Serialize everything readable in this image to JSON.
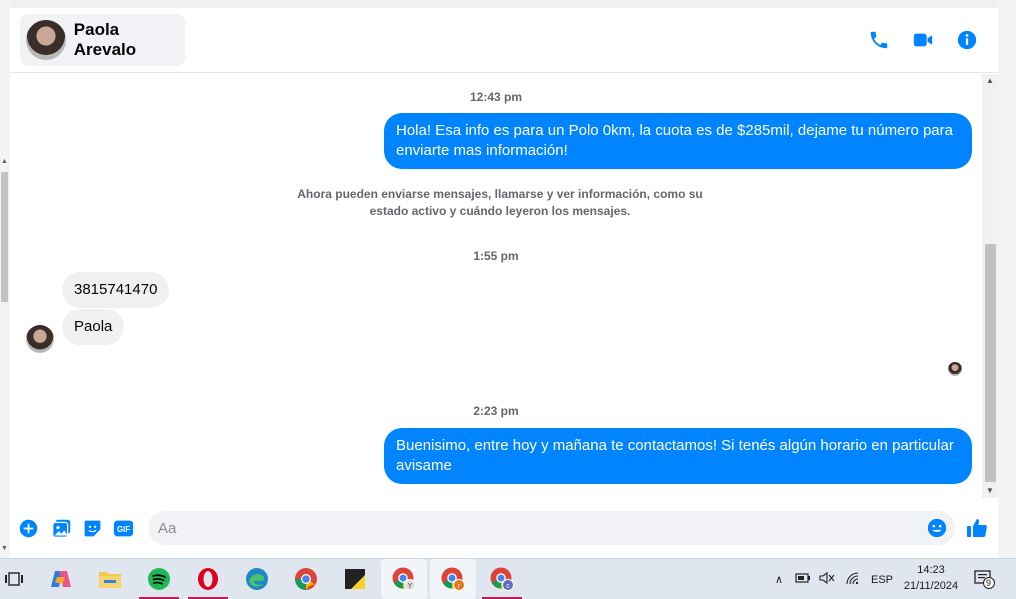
{
  "conversation": {
    "contact_name": "Paola Arevalo",
    "header_icons": [
      "phone-icon",
      "video-camera-icon",
      "info-icon"
    ]
  },
  "messages": {
    "ts1": "12:43 pm",
    "msg_out_1": "Hola! Esa info es para un Polo 0km, la cuota es de $285mil, dejame tu número para enviarte mas información!",
    "system_notice": "Ahora pueden enviarse mensajes, llamarse y ver información, como su estado activo y cuándo leyeron los mensajes.",
    "ts2": "1:55 pm",
    "msg_in_1": "3815741470",
    "msg_in_2": "Paola",
    "ts3": "2:23 pm",
    "msg_out_2": "Buenisimo, entre hoy y mañana te contactamos! Si tenés algún horario en particular avisame"
  },
  "composer": {
    "placeholder": "Aa",
    "icons": [
      "plus-icon",
      "photo-icon",
      "sticker-icon",
      "gif-icon",
      "emoji-icon",
      "thumbs-up-icon"
    ],
    "gif_label": "GIF"
  },
  "taskbar": {
    "language": "ESP",
    "time": "14:23",
    "date": "21/11/2024",
    "notification_count": "9",
    "apps": [
      "task-view",
      "copilot",
      "file-explorer",
      "spotify",
      "opera",
      "edge",
      "chrome",
      "sticky-notes",
      "chrome-profile-y",
      "chrome-profile-r",
      "chrome-profile-c"
    ]
  },
  "colors": {
    "accent": "#0084ff",
    "bubble_in": "#f0f0f0",
    "taskbar": "#dfe6ef"
  }
}
